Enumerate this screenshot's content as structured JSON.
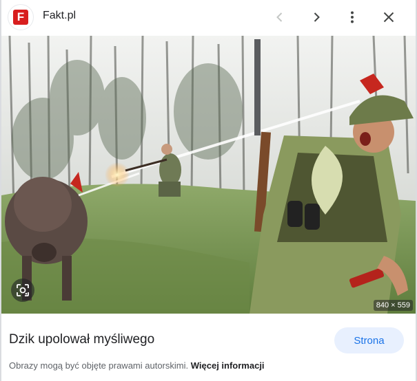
{
  "header": {
    "logo_letter": "F",
    "site_name": "Fakt.pl",
    "icons": {
      "prev": "chevron-left-icon",
      "next": "chevron-right-icon",
      "more": "more-vert-icon",
      "close": "close-icon"
    }
  },
  "image": {
    "dimensions": "840 × 559",
    "lens_icon": "lens-search-icon"
  },
  "result": {
    "title": "Dzik upolował myśliwego",
    "visit_button": "Strona",
    "copyright_text": "Obrazy mogą być objęte prawami autorskimi.",
    "more_info": "Więcej informacji"
  },
  "colors": {
    "brand_red": "#d81e1e",
    "accent_blue": "#1a73e8",
    "button_bg": "#e8f0fe"
  }
}
